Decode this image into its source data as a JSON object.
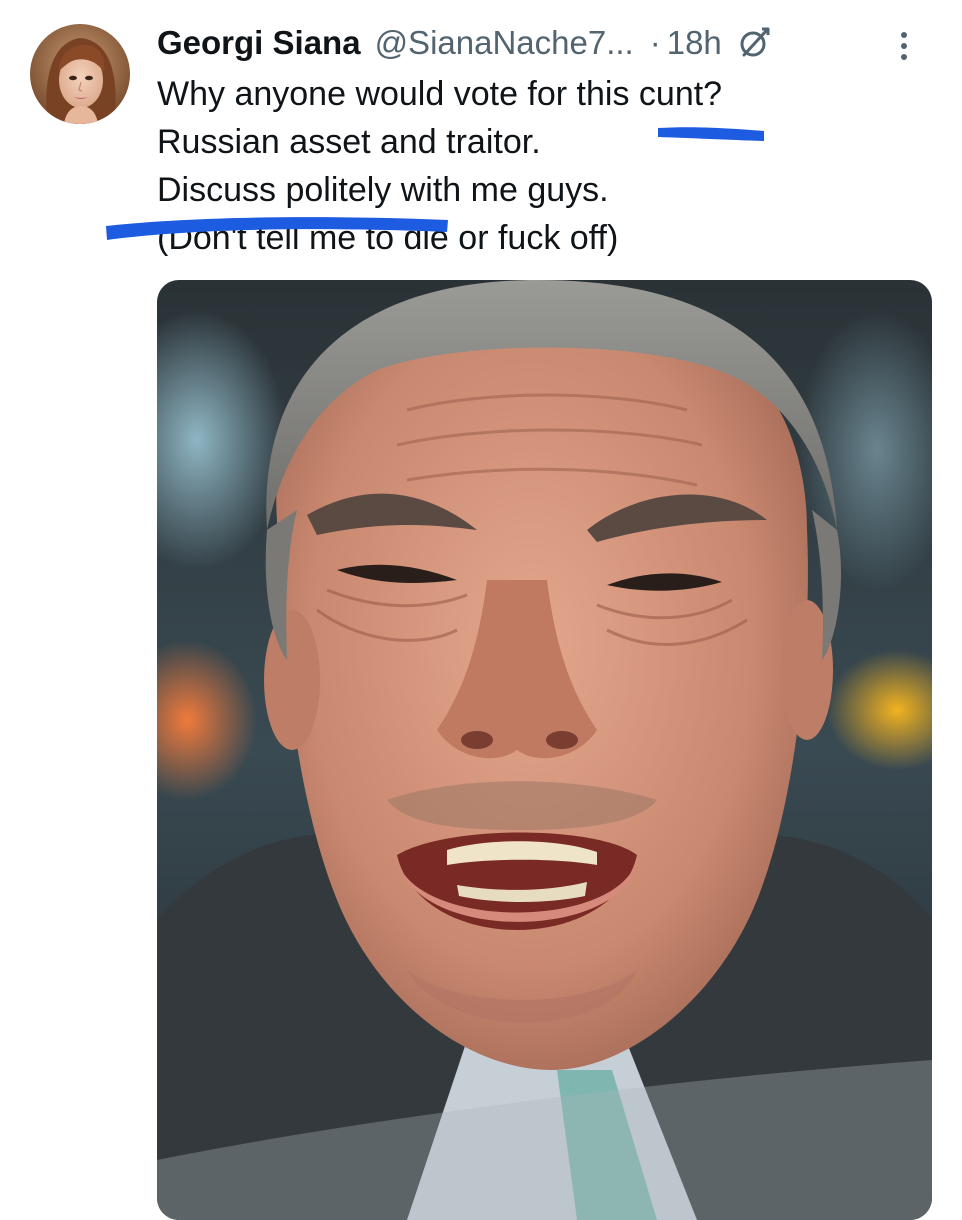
{
  "tweet": {
    "author": {
      "display_name": "Georgi Siana",
      "handle": "@SianaNache7...",
      "avatar_icon": "profile-photo"
    },
    "separator": "·",
    "timestamp": "18h",
    "edited_icon": "edit-slash-icon",
    "more_icon": "more-vertical-icon",
    "text_lines": [
      "Why anyone would vote for this cunt?",
      "Russian asset and traitor.",
      "Discuss politely with me guys.",
      "(Don't tell me to die or fuck off)"
    ],
    "annotation_color": "#1d5be0",
    "media": {
      "type": "photo"
    }
  },
  "colors": {
    "text_primary": "#0f1419",
    "text_secondary": "#536471",
    "background": "#ffffff"
  }
}
